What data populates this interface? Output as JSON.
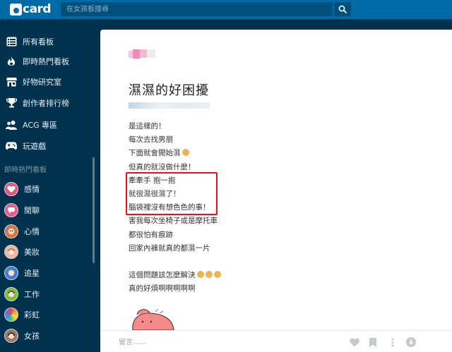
{
  "header": {
    "logo_text": "card",
    "search_placeholder": "在女孩板搜尋"
  },
  "sidebar": {
    "main_items": [
      {
        "label": "所有看板",
        "icon": "list-icon"
      },
      {
        "label": "即時熱門看板",
        "icon": "flame-icon"
      },
      {
        "label": "好物研究室",
        "icon": "store-icon"
      },
      {
        "label": "創作者排行榜",
        "icon": "trophy-icon"
      },
      {
        "label": "ACG 專區",
        "icon": "users-icon"
      },
      {
        "label": "玩遊戲",
        "icon": "gamepad-icon"
      }
    ],
    "section_title": "即時熱門看板",
    "boards": [
      {
        "label": "感情",
        "color": "#e4567c"
      },
      {
        "label": "閒聊",
        "color": "#e85a8a"
      },
      {
        "label": "心情",
        "color": "#c9774c"
      },
      {
        "label": "美妝",
        "color": "#f0b7a0"
      },
      {
        "label": "追星",
        "color": "#3f7fd0"
      },
      {
        "label": "工作",
        "color": "#7cbf3e"
      },
      {
        "label": "彩虹",
        "color": "#e2493c"
      },
      {
        "label": "女孩",
        "color": "#9c7b63"
      }
    ]
  },
  "post": {
    "title": "濕濕的好困擾",
    "lines": [
      "是這樣的！",
      "每次去找男朋",
      "下面就會開始濕",
      "但真的就沒做什麼！",
      "牽牽手 抱一抱",
      "就很濕很濕了！",
      "腦袋裡沒有想色色的事！",
      "害我每次坐椅子或是摩托車",
      "都很怕有痕跡",
      "回家內褲就真的都濕一片",
      "",
      "這個問題該怎麼解決",
      "真的好煩啊啊啊啊啊"
    ]
  },
  "footer": {
    "comment_placeholder": "留言……"
  },
  "colors": {
    "topbar": "#006aa6",
    "sidebar": "#00324e",
    "highlight": "#e1141c"
  }
}
